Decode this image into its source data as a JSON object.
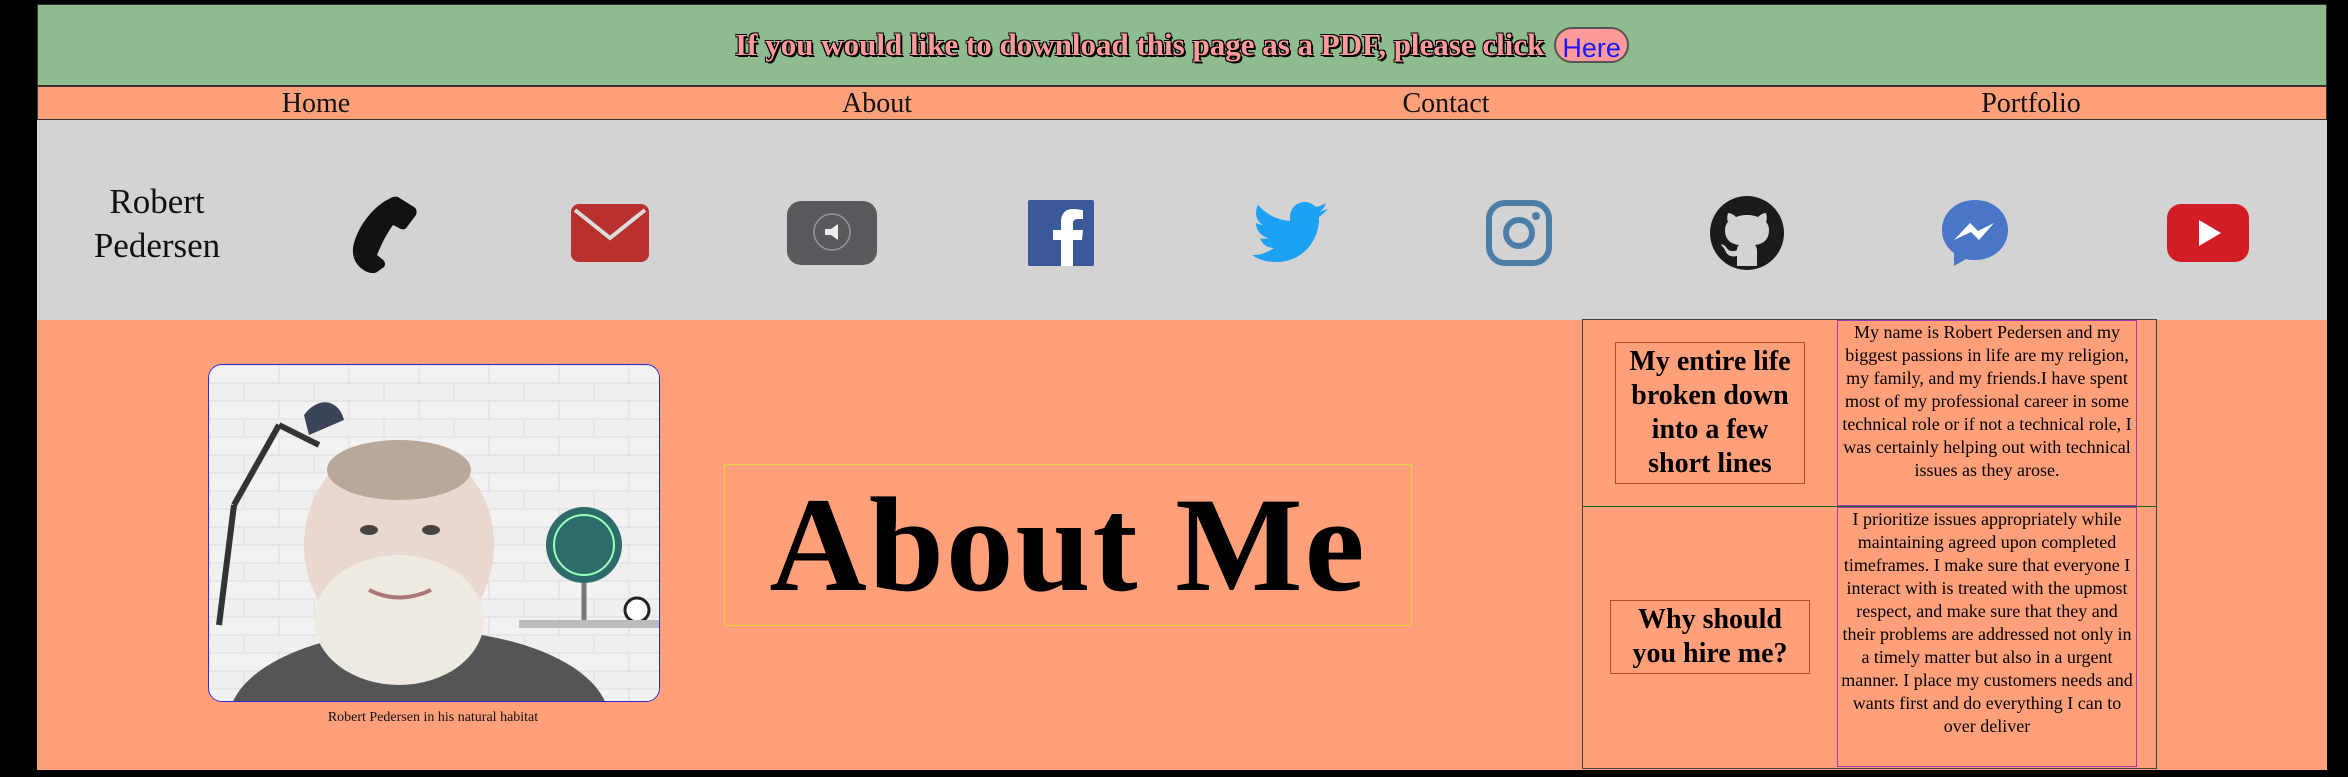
{
  "banner": {
    "text": "If you would like to download this page as a PDF, please click",
    "button_label": "Here"
  },
  "nav": {
    "items": [
      {
        "label": "Home"
      },
      {
        "label": "About"
      },
      {
        "label": "Contact"
      },
      {
        "label": "Portfolio"
      }
    ]
  },
  "social": {
    "name": "Robert Pedersen",
    "icons": [
      "phone-icon",
      "email-icon",
      "megaphone-icon",
      "facebook-icon",
      "twitter-icon",
      "instagram-icon",
      "github-icon",
      "messenger-icon",
      "youtube-icon"
    ]
  },
  "profile": {
    "caption": "Robert Pedersen in his natural habitat"
  },
  "about": {
    "heading": "About Me"
  },
  "info": {
    "rows": [
      {
        "question": "My entire life broken down into a few short lines",
        "answer": "My name is Robert Pedersen and my biggest passions in life are my religion, my family, and my friends.I have spent most of my professional career in some technical role or if not a technical role, I was certainly helping out with technical issues as they arose."
      },
      {
        "question": "Why should you hire me?",
        "answer": "I prioritize issues appropriately while maintaining agreed upon completed timeframes. I make sure that everyone I interact with is treated with the upmost respect, and make sure that they and their problems are addressed not only in a timely matter but also in a urgent manner. I place my customers needs and wants first and do everything I can to over deliver"
      }
    ]
  },
  "colors": {
    "page_bg": "#FFA07A",
    "banner_bg": "#8FBC8F",
    "social_bg": "#D3D3D3",
    "email": "#B8312F",
    "facebook": "#3B5998",
    "twitter": "#1DA1F2",
    "instagram": "#4C7EA8",
    "messenger": "#4A76C8",
    "youtube": "#D21D27"
  }
}
